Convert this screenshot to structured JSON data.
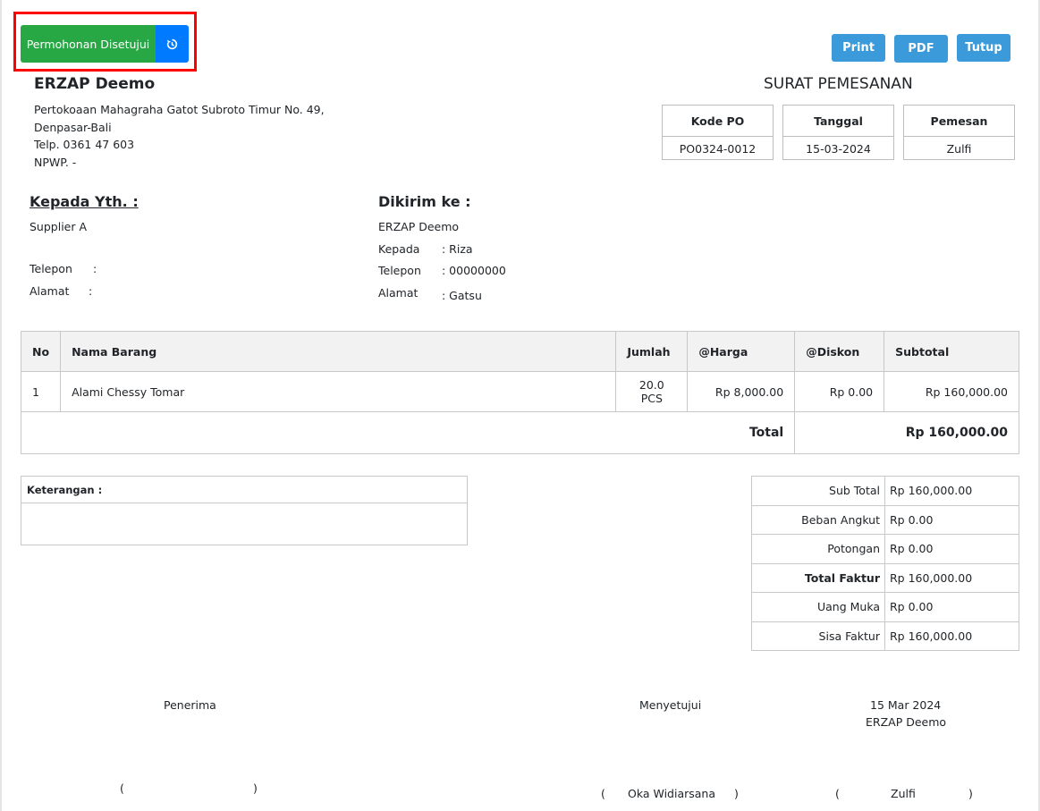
{
  "actions": {
    "status_label": "Permohonan Disetujui",
    "print_label": "Print",
    "pdf_label": "PDF",
    "close_label": "Tutup"
  },
  "company": {
    "name": "ERZAP Deemo",
    "address_line1": "Pertokoaan Mahagraha Gatot Subroto Timur No. 49,",
    "address_line2": "Denpasar-Bali",
    "phone": "Telp. 0361 47 603",
    "npwp": "NPWP. -"
  },
  "document": {
    "title": "SURAT PEMESANAN",
    "meta": [
      {
        "label": "Kode PO",
        "value": "PO0324-0012"
      },
      {
        "label": "Tanggal",
        "value": "15-03-2024"
      },
      {
        "label": "Pemesan",
        "value": "Zulfi"
      }
    ]
  },
  "recipient": {
    "title": "Kepada Yth. :",
    "name": "Supplier A",
    "phone_label": "Telepon",
    "phone_sep": ":",
    "address_label": "Alamat",
    "address_sep": ":"
  },
  "ship_to": {
    "title": "Dikirim ke :",
    "name": "ERZAP Deemo",
    "rows": [
      {
        "label": "Kepada",
        "value": ": Riza"
      },
      {
        "label": "Telepon",
        "value": ": 00000000"
      },
      {
        "label": "Alamat",
        "value": ": Gatsu"
      }
    ]
  },
  "items_table": {
    "headers": [
      "No",
      "Nama Barang",
      "Jumlah",
      "@Harga",
      "@Diskon",
      "Subtotal"
    ],
    "rows": [
      {
        "no": "1",
        "name": "Alami Chessy Tomar",
        "qty": "20.0 PCS",
        "price": "Rp 8,000.00",
        "discount": "Rp 0.00",
        "subtotal": "Rp 160,000.00"
      }
    ],
    "total_label": "Total",
    "total_value": "Rp 160,000.00"
  },
  "notes": {
    "label": "Keterangan :"
  },
  "summary": [
    {
      "label": "Sub Total",
      "value": "Rp 160,000.00",
      "bold": false
    },
    {
      "label": "Beban Angkut",
      "value": "Rp 0.00",
      "bold": false
    },
    {
      "label": "Potongan",
      "value": "Rp 0.00",
      "bold": false
    },
    {
      "label": "Total Faktur",
      "value": "Rp 160,000.00",
      "bold": true
    },
    {
      "label": "Uang Muka",
      "value": "Rp 0.00",
      "bold": false
    },
    {
      "label": "Sisa Faktur",
      "value": "Rp 160,000.00",
      "bold": false
    }
  ],
  "signatures": {
    "receiver_label": "Penerima",
    "receiver_open": "(",
    "receiver_close": ")",
    "approver_label": "Menyetujui",
    "approver_open": "(",
    "approver_name": "Oka Widiarsana",
    "approver_close": ")",
    "date": "15 Mar 2024",
    "company": "ERZAP Deemo",
    "signer_open": "(",
    "signer_name": "Zulfi",
    "signer_close": ")"
  }
}
